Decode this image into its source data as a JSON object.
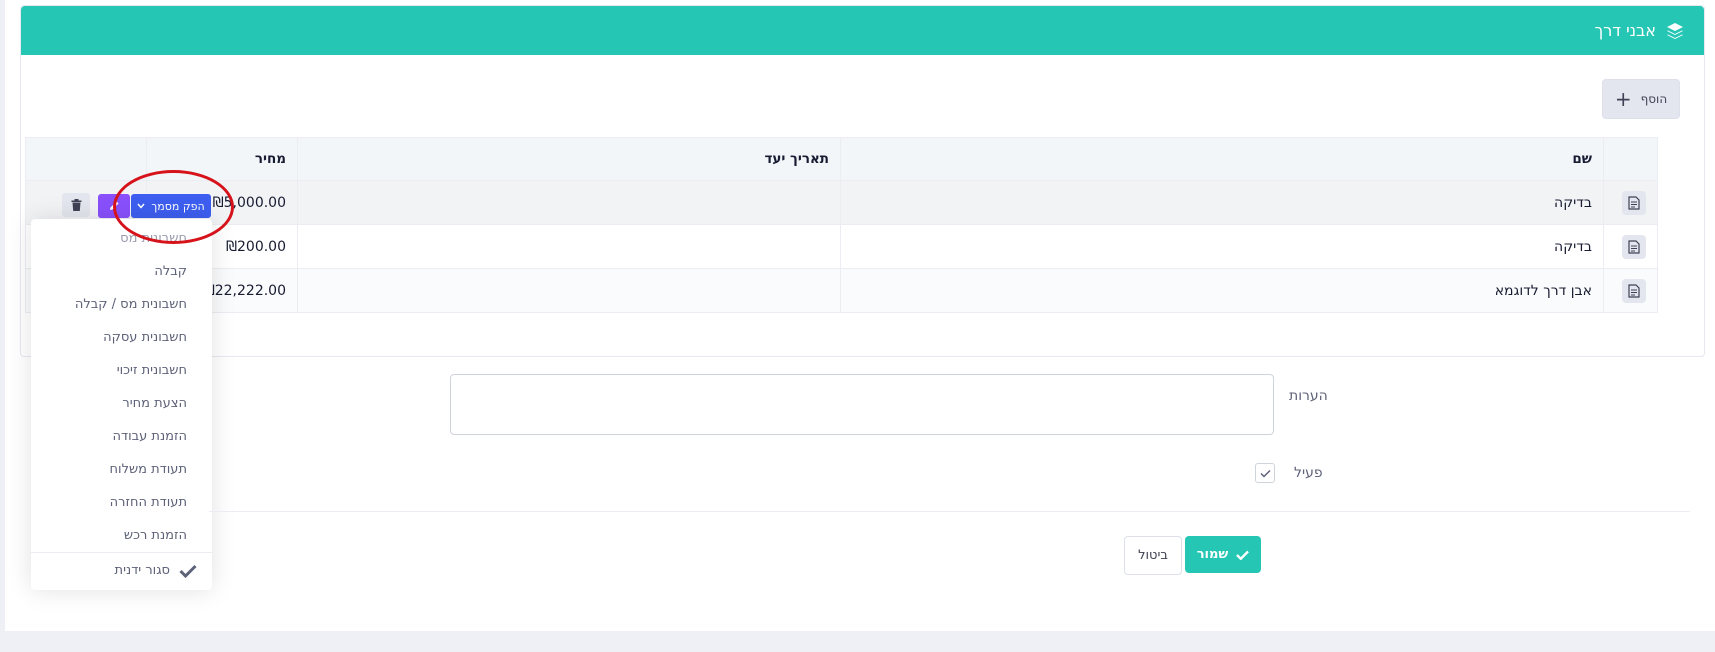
{
  "card": {
    "title": "אבני דרך",
    "title_icon": "layers-icon",
    "add_button_label": "הוסף"
  },
  "table": {
    "headers": {
      "name": "שם",
      "target_date": "תאריך יעד",
      "price": "מחיר"
    },
    "rows": [
      {
        "name": "בדיקה",
        "target_date": "",
        "price": "₪5,000.00"
      },
      {
        "name": "בדיקה",
        "target_date": "",
        "price": "₪200.00"
      },
      {
        "name": "אבן דרך לדוגמא",
        "target_date": "",
        "price": "₪22,222.00"
      }
    ]
  },
  "row_actions": {
    "produce_document_label": "הפק מסמך"
  },
  "produce_menu": {
    "items": [
      "חשבונית מס",
      "קבלה",
      "חשבונית מס / קבלה",
      "חשבונית עסקה",
      "חשבונית זיכוי",
      "הצעת מחיר",
      "הזמנת עבודה",
      "תעודת משלוח",
      "תעודת החזרה",
      "הזמנת רכש"
    ],
    "close_label": "סגור ידנית"
  },
  "form": {
    "notes_label": "הערות",
    "notes_value": "",
    "active_label": "פעיל",
    "active_checked": true
  },
  "footer": {
    "cancel_label": "ביטול",
    "save_label": "שמור"
  },
  "colors": {
    "accent": "#26c6b5",
    "produce_button": "#3d5ef0",
    "edit_button": "#8950fc",
    "annotation": "#d6121a"
  }
}
